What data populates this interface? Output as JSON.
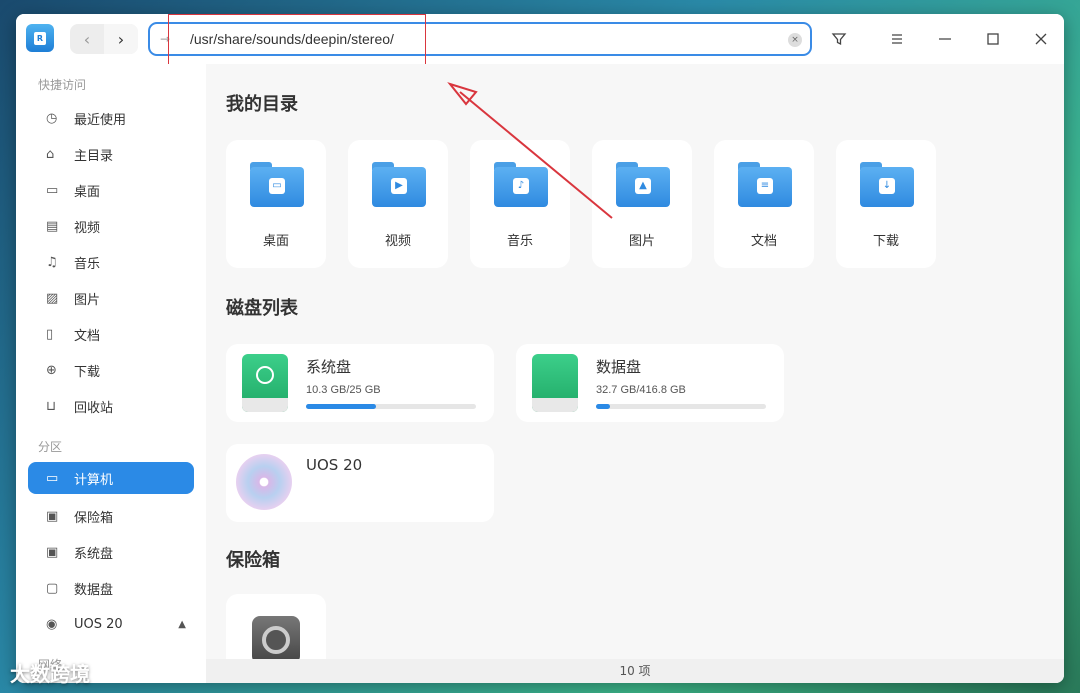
{
  "toolbar": {
    "back_icon": "chevron-left",
    "forward_icon": "chevron-right",
    "address_value": "/usr/share/sounds/deepin/stereo/"
  },
  "sidebar": {
    "quick_access_label": "快捷访问",
    "items": [
      {
        "label": "最近使用",
        "icon": "◷"
      },
      {
        "label": "主目录",
        "icon": "⌂"
      },
      {
        "label": "桌面",
        "icon": "▭"
      },
      {
        "label": "视频",
        "icon": "▤"
      },
      {
        "label": "音乐",
        "icon": "♫"
      },
      {
        "label": "图片",
        "icon": "▨"
      },
      {
        "label": "文档",
        "icon": "▯"
      },
      {
        "label": "下载",
        "icon": "⊕"
      },
      {
        "label": "回收站",
        "icon": "⊔"
      }
    ],
    "partition_label": "分区",
    "partitions": [
      {
        "label": "计算机",
        "icon": "▭"
      },
      {
        "label": "保险箱",
        "icon": "▣"
      },
      {
        "label": "系统盘",
        "icon": "▣"
      },
      {
        "label": "数据盘",
        "icon": "▢"
      },
      {
        "label": "UOS 20",
        "icon": "◉"
      }
    ],
    "network_label": "网络"
  },
  "main": {
    "my_dirs_title": "我的目录",
    "folders": [
      {
        "label": "桌面",
        "glyph": "▭"
      },
      {
        "label": "视频",
        "glyph": "▶"
      },
      {
        "label": "音乐",
        "glyph": "♪"
      },
      {
        "label": "图片",
        "glyph": "▲"
      },
      {
        "label": "文档",
        "glyph": "≡"
      },
      {
        "label": "下载",
        "glyph": "↓"
      }
    ],
    "disk_list_title": "磁盘列表",
    "disks": [
      {
        "name": "系统盘",
        "size": "10.3 GB/25 GB",
        "used_fraction": 0.41
      },
      {
        "name": "数据盘",
        "size": "32.7 GB/416.8 GB",
        "used_fraction": 0.08
      },
      {
        "name": "UOS 20"
      }
    ],
    "vault_title": "保险箱"
  },
  "status": {
    "count": "10 项"
  },
  "watermark": "大数跨境",
  "colors": {
    "accent": "#2b8ae6",
    "annotation": "#d9363e"
  }
}
